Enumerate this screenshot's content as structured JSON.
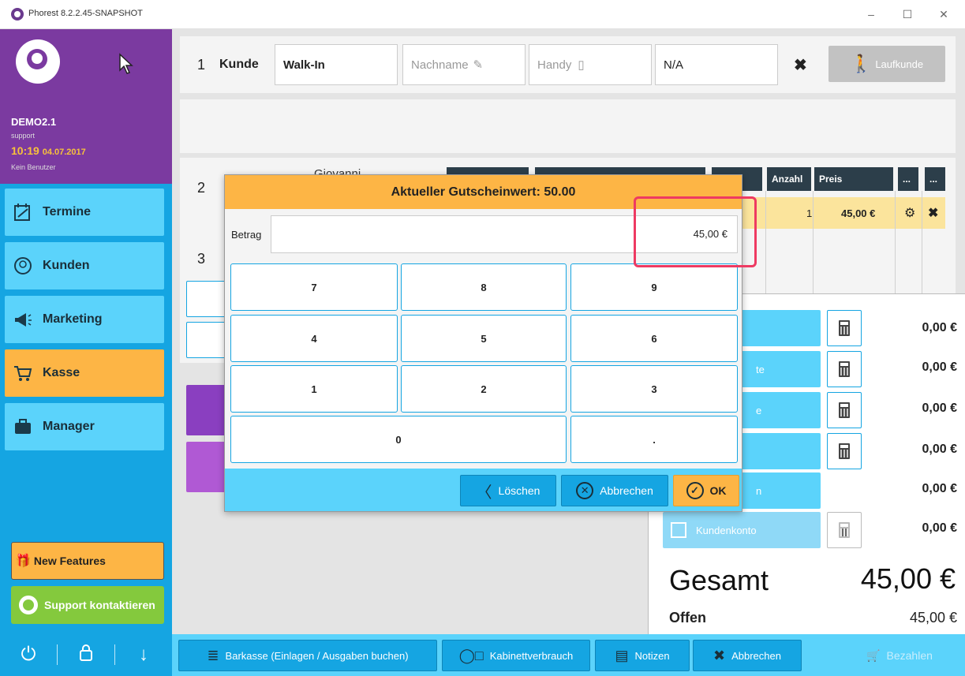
{
  "window": {
    "title": "Phorest 8.2.2.45-SNAPSHOT",
    "minimize": "–",
    "maximize": "☐",
    "close": "✕"
  },
  "sidebar": {
    "company": "DEMO2.1",
    "user": "support",
    "time": "10:19",
    "date": "04.07.2017",
    "no_user": "Kein Benutzer",
    "nav": [
      {
        "label": "Termine",
        "icon": "calendar-icon"
      },
      {
        "label": "Kunden",
        "icon": "head-icon"
      },
      {
        "label": "Marketing",
        "icon": "megaphone-icon"
      },
      {
        "label": "Kasse",
        "icon": "cart-icon"
      },
      {
        "label": "Manager",
        "icon": "briefcase-icon"
      }
    ],
    "new_features": "New Features",
    "support": "Support kontaktieren"
  },
  "kunde": {
    "number": "1",
    "label": "Kunde",
    "first_name": "Walk-In",
    "last_name_placeholder": "Nachname",
    "phone_placeholder": "Handy",
    "na": "N/A",
    "laufkunde": "Laufkunde"
  },
  "section2": {
    "number2": "2",
    "number3": "3",
    "staff": "Giovanni",
    "col_anzahl": "Anzahl",
    "col_preis": "Preis",
    "col_more": "...",
    "row_anzahl": "1",
    "row_preis": "45,00 €"
  },
  "payment": {
    "rows": [
      {
        "label": "",
        "amount": "0,00 €"
      },
      {
        "label": "te",
        "amount": "0,00 €"
      },
      {
        "label": "e",
        "amount": "0,00 €"
      },
      {
        "label": "",
        "amount": "0,00 €"
      },
      {
        "label": "n",
        "amount": "0,00 €"
      },
      {
        "label": "Kundenkonto",
        "amount": "0,00 €"
      }
    ],
    "gesamt_label": "Gesamt",
    "gesamt_value": "45,00 €",
    "offen_label": "Offen",
    "offen_value": "45,00 €"
  },
  "toolbar": {
    "barkasse": "Barkasse (Einlagen / Ausgaben buchen)",
    "kabinett": "Kabinettverbrauch",
    "notizen": "Notizen",
    "abbrechen": "Abbrechen",
    "bezahlen": "Bezahlen"
  },
  "dialog": {
    "title": "Aktueller Gutscheinwert: 50.00",
    "betrag_label": "Betrag",
    "betrag_value": "45,00 €",
    "keys": [
      "7",
      "8",
      "9",
      "4",
      "5",
      "6",
      "1",
      "2",
      "3",
      "0",
      "."
    ],
    "loeschen": "Löschen",
    "abbrechen": "Abbrechen",
    "ok": "OK"
  },
  "colors": {
    "sidebar": "#15a5e2",
    "brand": "#7b3aa0",
    "accent": "#fdb545",
    "highlight": "#ee3a62"
  }
}
